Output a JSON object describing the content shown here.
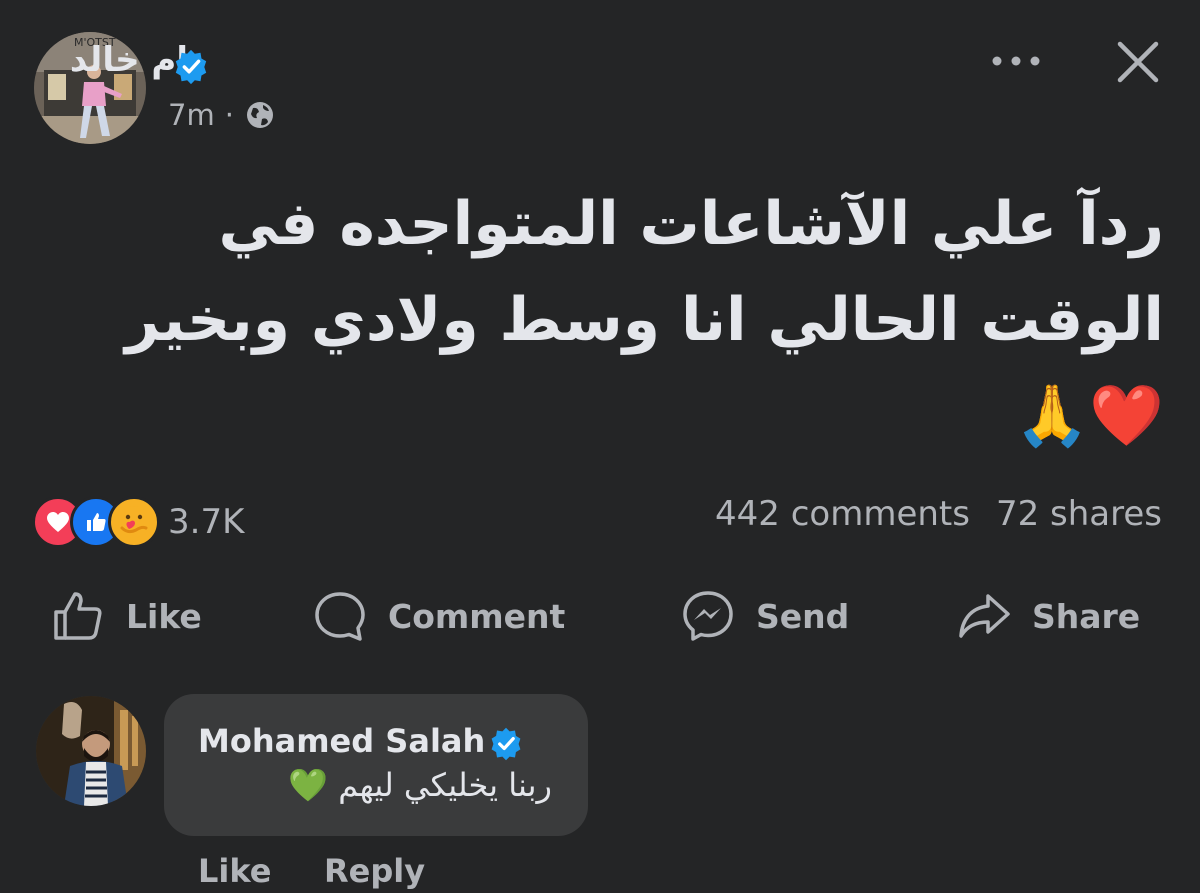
{
  "post": {
    "author": "ام خالد",
    "time": "7m",
    "separator": "·",
    "text": "ردآ علي الآشاعات المتواجده في الوقت الحالي انا وسط ولادي وبخير ❤️🙏",
    "privacy_icon": "globe-icon",
    "verified_icon": "verified-badge-icon"
  },
  "header": {
    "more_icon": "more-options-icon",
    "close_icon": "close-icon"
  },
  "stats": {
    "reaction_icons": [
      "love-reaction",
      "like-reaction",
      "care-reaction"
    ],
    "reactions_count": "3.7K",
    "comments": "442 comments",
    "shares": "72 shares"
  },
  "actions": {
    "like": "Like",
    "comment": "Comment",
    "send": "Send",
    "share": "Share"
  },
  "comment": {
    "author": "Mohamed Salah",
    "text": "ربنا يخليكي ليهم 💚",
    "like": "Like",
    "reply": "Reply"
  },
  "colors": {
    "background": "#242526",
    "bubble": "#3a3b3c",
    "text_primary": "#e4e6eb",
    "text_secondary": "#b0b3b8",
    "verified_blue": "#1d9bf0",
    "love_red": "#f33e58",
    "like_blue": "#1877f2",
    "care_yellow": "#f7b125"
  }
}
